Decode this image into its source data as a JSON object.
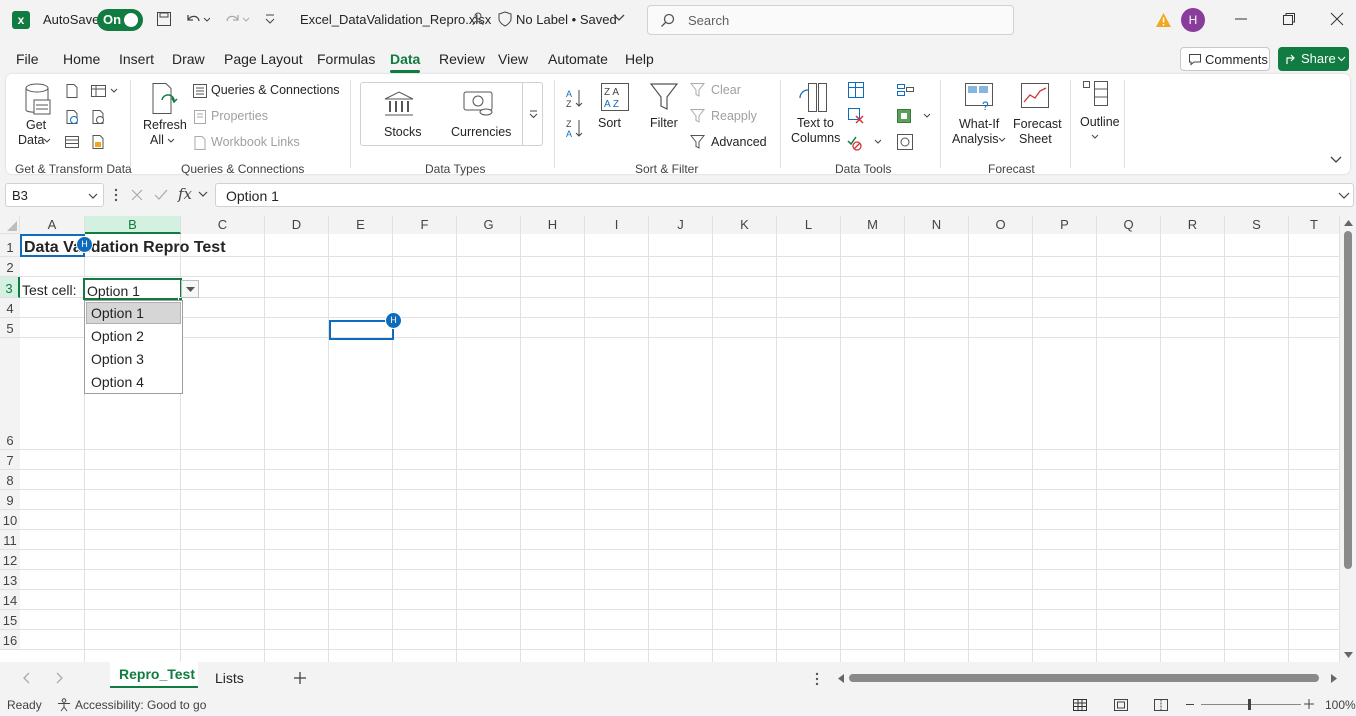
{
  "titlebar": {
    "autosave_label": "AutoSave",
    "autosave_state": "On",
    "filename": "Excel_DataValidation_Repro.xlsx",
    "label_status": "No Label • Saved",
    "search_placeholder": "Search",
    "user_initial": "H"
  },
  "menu": {
    "items": [
      "File",
      "Home",
      "Insert",
      "Draw",
      "Page Layout",
      "Formulas",
      "Data",
      "Review",
      "View",
      "Automate",
      "Help"
    ],
    "active": "Data",
    "comments_label": "Comments",
    "share_label": "Share"
  },
  "ribbon": {
    "get_data": [
      "Get",
      "Data"
    ],
    "queries_connections": "Queries & Connections",
    "properties": "Properties",
    "workbook_links": "Workbook Links",
    "refresh_all": [
      "Refresh",
      "All"
    ],
    "stocks": "Stocks",
    "currencies": "Currencies",
    "sort": "Sort",
    "filter": "Filter",
    "clear": "Clear",
    "reapply": "Reapply",
    "advanced": "Advanced",
    "text_to_columns": [
      "Text to",
      "Columns"
    ],
    "what_if": [
      "What-If",
      "Analysis"
    ],
    "forecast_sheet": [
      "Forecast",
      "Sheet"
    ],
    "outline": "Outline",
    "groups": {
      "get_transform": "Get & Transform Data",
      "queries": "Queries & Connections",
      "data_types": "Data Types",
      "sort_filter": "Sort & Filter",
      "data_tools": "Data Tools",
      "forecast": "Forecast"
    }
  },
  "formula_bar": {
    "name_box": "B3",
    "fx": "fx",
    "formula": "Option 1"
  },
  "grid": {
    "columns": [
      "A",
      "B",
      "C",
      "D",
      "E",
      "F",
      "G",
      "H",
      "I",
      "J",
      "K",
      "L",
      "M",
      "N",
      "O",
      "P",
      "Q",
      "R",
      "S",
      "T"
    ],
    "rows": [
      "1",
      "2",
      "3",
      "4",
      "5",
      "6",
      "7",
      "8",
      "9",
      "10",
      "11",
      "12",
      "13",
      "14",
      "15",
      "16"
    ],
    "a1_title": "Data Validation Repro Test",
    "a3_label": "Test cell:",
    "b3_value": "Option 1",
    "presence_initial": "H",
    "dropdown_options": [
      "Option 1",
      "Option 2",
      "Option 3",
      "Option 4"
    ],
    "selected_option": "Option 1"
  },
  "sheets": {
    "tabs": [
      "Repro_Test",
      "Lists"
    ],
    "active": "Repro_Test"
  },
  "status": {
    "ready": "Ready",
    "accessibility": "Accessibility: Good to go",
    "zoom": "100%"
  },
  "colors": {
    "excel_green": "#107c41",
    "accent_blue": "#0f6cbd",
    "avatar": "#8a3c9a"
  }
}
